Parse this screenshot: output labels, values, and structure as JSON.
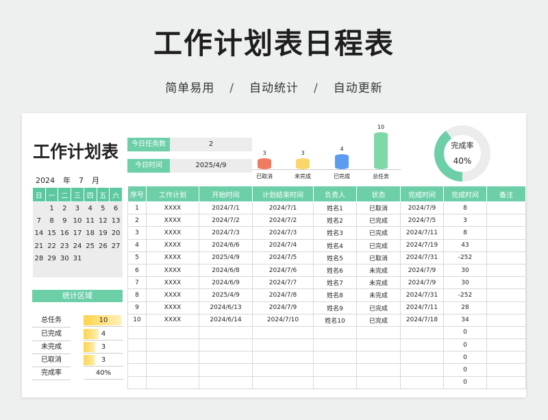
{
  "hero": {
    "title": "工作计划表日程表",
    "subtitle": [
      "简单易用",
      "自动统计",
      "自动更新"
    ],
    "separator": "/"
  },
  "sheet": {
    "title": "工作计划表",
    "year": "2024",
    "year_unit": "年",
    "month": "7",
    "month_unit": "月",
    "weekdays": [
      "日",
      "一",
      "二",
      "三",
      "四",
      "五",
      "六"
    ],
    "calendar": [
      [
        "",
        "1",
        "2",
        "3",
        "4",
        "5",
        "6"
      ],
      [
        "7",
        "8",
        "9",
        "10",
        "11",
        "12",
        "13"
      ],
      [
        "14",
        "15",
        "16",
        "17",
        "18",
        "19",
        "20"
      ],
      [
        "21",
        "22",
        "23",
        "24",
        "25",
        "26",
        "27"
      ],
      [
        "28",
        "29",
        "30",
        "31",
        "",
        "",
        ""
      ],
      [
        "",
        "",
        "",
        "",
        "",
        "",
        ""
      ]
    ],
    "stats_title": "统计区域",
    "stats": [
      {
        "label": "总任务",
        "value": "10",
        "fraction": 1.0
      },
      {
        "label": "已完成",
        "value": "4",
        "fraction": 0.4
      },
      {
        "label": "未完成",
        "value": "3",
        "fraction": 0.3
      },
      {
        "label": "已取消",
        "value": "3",
        "fraction": 0.3
      },
      {
        "label": "完成率",
        "value": "40%",
        "fraction": 0
      }
    ],
    "today_tasks_label": "今日任务数",
    "today_tasks_value": "2",
    "today_time_label": "今日时间",
    "today_time_value": "2025/4/9"
  },
  "chart_data": [
    {
      "type": "bar",
      "categories": [
        "已取消",
        "未完成",
        "已完成",
        "总任务"
      ],
      "values": [
        3,
        3,
        4,
        10
      ],
      "colors": [
        "#f07a62",
        "#fad56a",
        "#5b9cf0",
        "#7fd8a8"
      ]
    },
    {
      "type": "pie",
      "title": "完成率",
      "label": "40%",
      "values": [
        40,
        60
      ],
      "colors": [
        "#6ccfa8",
        "#ececec"
      ]
    }
  ],
  "table": {
    "headers": [
      "序号",
      "工作计划",
      "开始时间",
      "计划结束时间",
      "负责人",
      "状态",
      "完成时间",
      "完成时间",
      "备注"
    ],
    "rows": [
      [
        "1",
        "XXXX",
        "2024/7/1",
        "2024/7/1",
        "姓名1",
        "已取消",
        "2024/7/9",
        "8",
        ""
      ],
      [
        "2",
        "XXXX",
        "2024/7/2",
        "2024/7/2",
        "姓名2",
        "已完成",
        "2024/7/5",
        "3",
        ""
      ],
      [
        "3",
        "XXXX",
        "2024/7/3",
        "2024/7/3",
        "姓名3",
        "已完成",
        "2024/7/11",
        "8",
        ""
      ],
      [
        "4",
        "XXXX",
        "2024/6/6",
        "2024/7/4",
        "姓名4",
        "已完成",
        "2024/7/19",
        "43",
        ""
      ],
      [
        "5",
        "XXXX",
        "2025/4/9",
        "2024/7/5",
        "姓名5",
        "已取消",
        "2024/7/31",
        "-252",
        ""
      ],
      [
        "6",
        "XXXX",
        "2024/6/8",
        "2024/7/6",
        "姓名6",
        "未完成",
        "2024/7/9",
        "30",
        ""
      ],
      [
        "7",
        "XXXX",
        "2024/6/9",
        "2024/7/7",
        "姓名7",
        "未完成",
        "2024/7/9",
        "30",
        ""
      ],
      [
        "8",
        "XXXX",
        "2025/4/9",
        "2024/7/8",
        "姓名8",
        "未完成",
        "2024/7/31",
        "-252",
        ""
      ],
      [
        "9",
        "XXXX",
        "2024/6/13",
        "2024/7/9",
        "姓名9",
        "已完成",
        "2024/7/11",
        "28",
        ""
      ],
      [
        "10",
        "XXXX",
        "2024/6/14",
        "2024/7/10",
        "姓名10",
        "已完成",
        "2024/7/18",
        "34",
        ""
      ],
      [
        "",
        "",
        "",
        "",
        "",
        "",
        "",
        "0",
        ""
      ],
      [
        "",
        "",
        "",
        "",
        "",
        "",
        "",
        "0",
        ""
      ],
      [
        "",
        "",
        "",
        "",
        "",
        "",
        "",
        "0",
        ""
      ],
      [
        "",
        "",
        "",
        "",
        "",
        "",
        "",
        "0",
        ""
      ],
      [
        "",
        "",
        "",
        "",
        "",
        "",
        "",
        "0",
        ""
      ]
    ]
  }
}
